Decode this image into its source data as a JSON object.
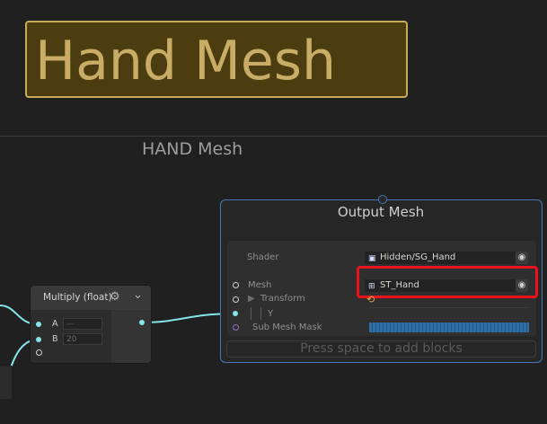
{
  "sticky_note": {
    "title": "Hand Mesh"
  },
  "group": {
    "title": "HAND Mesh"
  },
  "multiply_node": {
    "title": "Multiply (float)",
    "inputs": [
      {
        "label": "A",
        "value": "—"
      },
      {
        "label": "B",
        "value": "20"
      }
    ]
  },
  "output_node": {
    "title": "Output Mesh",
    "fields": {
      "shader_label": "Shader",
      "shader_value": "Hidden/SG_Hand",
      "mesh_label": "Mesh",
      "mesh_value": "ST_Hand",
      "transform_label": "Transform",
      "y_label": "Y",
      "submesh_label": "Sub Mesh Mask"
    },
    "add_blocks_hint": "Press space to add blocks"
  },
  "colors": {
    "accent": "#4a77b3",
    "port_cyan": "#84e4e7",
    "highlight": "#e8131d",
    "sticky_bg": "#4b3d10"
  }
}
